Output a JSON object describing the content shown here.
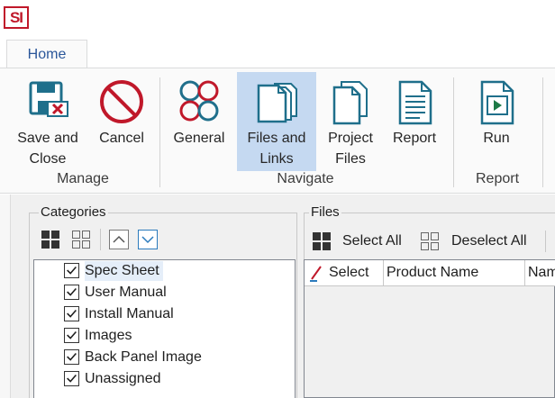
{
  "app": {
    "logo_text": "SI"
  },
  "tabs": [
    {
      "label": "Home",
      "active": true
    }
  ],
  "ribbon": {
    "buttons": {
      "save_and_close": {
        "line1": "Save and",
        "line2": "Close",
        "icon": "save-close-icon"
      },
      "cancel": {
        "line1": "Cancel",
        "icon": "cancel-icon"
      },
      "general": {
        "line1": "General",
        "icon": "general-icon"
      },
      "files_and_links": {
        "line1": "Files and",
        "line2": "Links",
        "icon": "files-links-icon",
        "selected": true
      },
      "project_files": {
        "line1": "Project",
        "line2": "Files",
        "icon": "project-files-icon"
      },
      "report": {
        "line1": "Report",
        "icon": "report-icon"
      },
      "run": {
        "line1": "Run",
        "icon": "run-icon"
      }
    },
    "groups": {
      "manage": "Manage",
      "navigate": "Navigate",
      "report": "Report"
    }
  },
  "categories": {
    "title": "Categories",
    "items": [
      {
        "label": "Spec Sheet",
        "checked": true,
        "highlighted": true
      },
      {
        "label": "User Manual",
        "checked": true
      },
      {
        "label": "Install Manual",
        "checked": true
      },
      {
        "label": "Images",
        "checked": true
      },
      {
        "label": "Back Panel Image",
        "checked": true
      },
      {
        "label": "Unassigned",
        "checked": true
      }
    ]
  },
  "files": {
    "title": "Files",
    "select_all": "Select All",
    "deselect_all": "Deselect All",
    "columns": [
      "Select",
      "Product Name",
      "Nam"
    ]
  },
  "colors": {
    "accent": "#2b579a",
    "selected_ribbon": "#c5d9f1",
    "icon_teal": "#1f6f8b",
    "icon_red": "#c0182a",
    "icon_green": "#1e7a46"
  }
}
